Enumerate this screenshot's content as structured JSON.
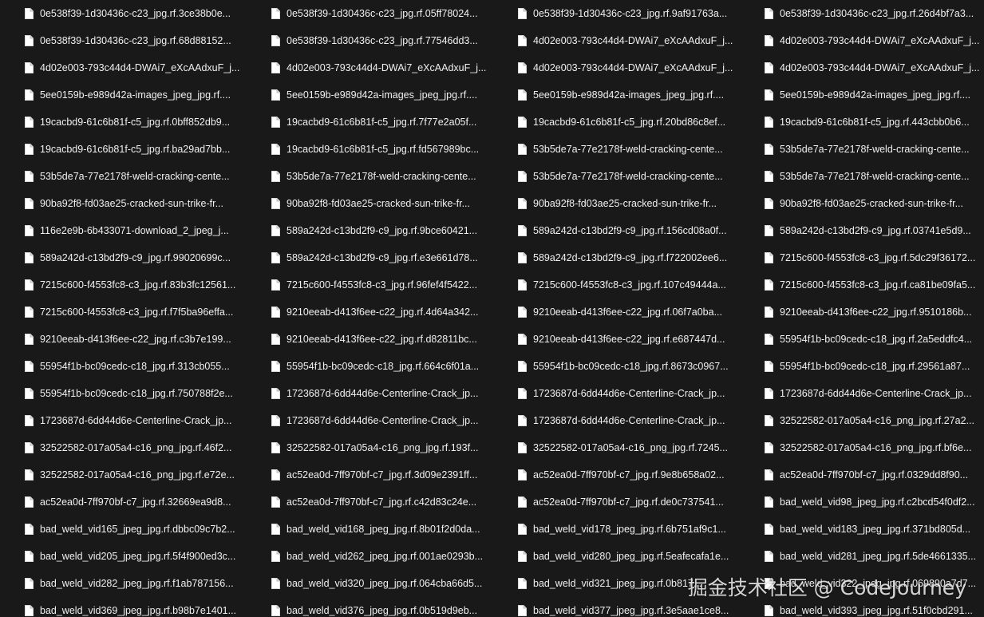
{
  "icon": "file-icon",
  "colors": {
    "background": "#191919",
    "text": "#f0f0f0",
    "icon": "#ffffff"
  },
  "files": [
    "0e538f39-1d30436c-c23_jpg.rf.3ce38b0e...",
    "0e538f39-1d30436c-c23_jpg.rf.05ff78024...",
    "0e538f39-1d30436c-c23_jpg.rf.9af91763a...",
    "0e538f39-1d30436c-c23_jpg.rf.26d4bf7a3...",
    "0e538f39-1d30436c-c23_jpg.rf.68d88152...",
    "0e538f39-1d30436c-c23_jpg.rf.77546dd3...",
    "4d02e003-793c44d4-DWAi7_eXcAAdxuF_j...",
    "4d02e003-793c44d4-DWAi7_eXcAAdxuF_j...",
    "4d02e003-793c44d4-DWAi7_eXcAAdxuF_j...",
    "4d02e003-793c44d4-DWAi7_eXcAAdxuF_j...",
    "4d02e003-793c44d4-DWAi7_eXcAAdxuF_j...",
    "4d02e003-793c44d4-DWAi7_eXcAAdxuF_j...",
    "5ee0159b-e989d42a-images_jpeg_jpg.rf....",
    "5ee0159b-e989d42a-images_jpeg_jpg.rf....",
    "5ee0159b-e989d42a-images_jpeg_jpg.rf....",
    "5ee0159b-e989d42a-images_jpeg_jpg.rf....",
    "19cacbd9-61c6b81f-c5_jpg.rf.0bff852db9...",
    "19cacbd9-61c6b81f-c5_jpg.rf.7f77e2a05f...",
    "19cacbd9-61c6b81f-c5_jpg.rf.20bd86c8ef...",
    "19cacbd9-61c6b81f-c5_jpg.rf.443cbb0b6...",
    "19cacbd9-61c6b81f-c5_jpg.rf.ba29ad7bb...",
    "19cacbd9-61c6b81f-c5_jpg.rf.fd567989bc...",
    "53b5de7a-77e2178f-weld-cracking-cente...",
    "53b5de7a-77e2178f-weld-cracking-cente...",
    "53b5de7a-77e2178f-weld-cracking-cente...",
    "53b5de7a-77e2178f-weld-cracking-cente...",
    "53b5de7a-77e2178f-weld-cracking-cente...",
    "53b5de7a-77e2178f-weld-cracking-cente...",
    "90ba92f8-fd03ae25-cracked-sun-trike-fr...",
    "90ba92f8-fd03ae25-cracked-sun-trike-fr...",
    "90ba92f8-fd03ae25-cracked-sun-trike-fr...",
    "90ba92f8-fd03ae25-cracked-sun-trike-fr...",
    "116e2e9b-6b433071-download_2_jpeg_j...",
    "589a242d-c13bd2f9-c9_jpg.rf.9bce60421...",
    "589a242d-c13bd2f9-c9_jpg.rf.156cd08a0f...",
    "589a242d-c13bd2f9-c9_jpg.rf.03741e5d9...",
    "589a242d-c13bd2f9-c9_jpg.rf.99020699c...",
    "589a242d-c13bd2f9-c9_jpg.rf.e3e661d78...",
    "589a242d-c13bd2f9-c9_jpg.rf.f722002ee6...",
    "7215c600-f4553fc8-c3_jpg.rf.5dc29f36172...",
    "7215c600-f4553fc8-c3_jpg.rf.83b3fc12561...",
    "7215c600-f4553fc8-c3_jpg.rf.96fef4f5422...",
    "7215c600-f4553fc8-c3_jpg.rf.107c49444a...",
    "7215c600-f4553fc8-c3_jpg.rf.ca81be09fa5...",
    "7215c600-f4553fc8-c3_jpg.rf.f7f5ba96effa...",
    "9210eeab-d413f6ee-c22_jpg.rf.4d64a342...",
    "9210eeab-d413f6ee-c22_jpg.rf.06f7a0ba...",
    "9210eeab-d413f6ee-c22_jpg.rf.9510186b...",
    "9210eeab-d413f6ee-c22_jpg.rf.c3b7e199...",
    "9210eeab-d413f6ee-c22_jpg.rf.d82811bc...",
    "9210eeab-d413f6ee-c22_jpg.rf.e687447d...",
    "55954f1b-bc09cedc-c18_jpg.rf.2a5eddfc4...",
    "55954f1b-bc09cedc-c18_jpg.rf.313cb055...",
    "55954f1b-bc09cedc-c18_jpg.rf.664c6f01a...",
    "55954f1b-bc09cedc-c18_jpg.rf.8673c0967...",
    "55954f1b-bc09cedc-c18_jpg.rf.29561a87...",
    "55954f1b-bc09cedc-c18_jpg.rf.750788f2e...",
    "1723687d-6dd44d6e-Centerline-Crack_jp...",
    "1723687d-6dd44d6e-Centerline-Crack_jp...",
    "1723687d-6dd44d6e-Centerline-Crack_jp...",
    "1723687d-6dd44d6e-Centerline-Crack_jp...",
    "1723687d-6dd44d6e-Centerline-Crack_jp...",
    "1723687d-6dd44d6e-Centerline-Crack_jp...",
    "32522582-017a05a4-c16_png_jpg.rf.27a2...",
    "32522582-017a05a4-c16_png_jpg.rf.46f2...",
    "32522582-017a05a4-c16_png_jpg.rf.193f...",
    "32522582-017a05a4-c16_png_jpg.rf.7245...",
    "32522582-017a05a4-c16_png_jpg.rf.bf6e...",
    "32522582-017a05a4-c16_png_jpg.rf.e72e...",
    "ac52ea0d-7ff970bf-c7_jpg.rf.3d09e2391ff...",
    "ac52ea0d-7ff970bf-c7_jpg.rf.9e8b658a02...",
    "ac52ea0d-7ff970bf-c7_jpg.rf.0329dd8f90...",
    "ac52ea0d-7ff970bf-c7_jpg.rf.32669ea9d8...",
    "ac52ea0d-7ff970bf-c7_jpg.rf.c42d83c24e...",
    "ac52ea0d-7ff970bf-c7_jpg.rf.de0c737541...",
    "bad_weld_vid98_jpeg_jpg.rf.c2bcd54f0df2...",
    "bad_weld_vid165_jpeg_jpg.rf.dbbc09c7b2...",
    "bad_weld_vid168_jpeg_jpg.rf.8b01f2d0da...",
    "bad_weld_vid178_jpeg_jpg.rf.6b751af9c1...",
    "bad_weld_vid183_jpeg_jpg.rf.371bd805d...",
    "bad_weld_vid205_jpeg_jpg.rf.5f4f900ed3c...",
    "bad_weld_vid262_jpeg_jpg.rf.001ae0293b...",
    "bad_weld_vid280_jpeg_jpg.rf.5eafecafa1e...",
    "bad_weld_vid281_jpeg_jpg.rf.5de4661335...",
    "bad_weld_vid282_jpeg_jpg.rf.f1ab787156...",
    "bad_weld_vid320_jpeg_jpg.rf.064cba66d5...",
    "bad_weld_vid321_jpeg_jpg.rf.0b817...",
    "bad_weld_vid322_jpeg_jpg.rf.069890a7d7...",
    "bad_weld_vid369_jpeg_jpg.rf.b98b7e1401...",
    "bad_weld_vid376_jpeg_jpg.rf.0b519d9eb...",
    "bad_weld_vid377_jpeg_jpg.rf.3e5aae1ce8...",
    "bad_weld_vid393_jpeg_jpg.rf.51f0cbd291..."
  ],
  "watermark": "掘金技术社区 @ CodeJourney"
}
